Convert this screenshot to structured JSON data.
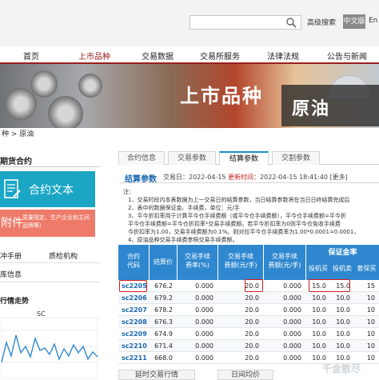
{
  "topbar": {
    "search_button": "高级搜索",
    "lang_active": "中文版",
    "lang_en": "En"
  },
  "nav": {
    "items": [
      "首页",
      "上市品种",
      "交易数据",
      "交易所服务",
      "法律法规",
      "公告与新闻"
    ],
    "active_index": 1,
    "accent": "#9b1e1e"
  },
  "banner": {
    "title": "上市品种",
    "subtitle": "原油"
  },
  "breadcrumb": "种 > 原油",
  "sidebar": {
    "section_title": "期货合约",
    "contract_button": "合约文本",
    "notice_button": "附件",
    "notice_text": "质量规定、生产企业和主间品牌等）",
    "links": [
      "冲手册",
      "质检机构",
      "库信息"
    ],
    "chart_title": "行情走势",
    "chart_label": "SC"
  },
  "tabs": {
    "items": [
      "合约信息",
      "交易参数",
      "结算参数",
      "交割参数"
    ],
    "active_index": 2
  },
  "settle": {
    "title": "结算参数",
    "date_label": "交易日：",
    "date_value": "2022-04-15",
    "update_label": "更新时间：",
    "update_value": "2022-04-15 18:41:40",
    "more": "[更多]"
  },
  "notes": [
    "注：",
    "1、交易时段内本表数据为上一交易日的结算参数，当日结算参数将在当日日终结算完成后",
    "2、表中的数据保证金、手续费，单位：元/手",
    "3、平今折扣率用于计算平今仓手续费额（或平今仓手续费额），平今仓手续费额=平今折",
    "平今仓手续费额=平今仓折扣率*交易手续费额。若平今折扣率为0则平今仓免收手续费",
    "今折扣率为1.00，交易手续费额为0.1%。则对应平今仓手续费率为1.00*0.0001=0.0001，",
    "4、原油品种交易手续费参照交易手续费额。"
  ],
  "table": {
    "headers": {
      "code": "合约\n代码",
      "price": "结算价",
      "fee_rate": "交易手续\n费率(%)",
      "fee_amount": "交易手续\n费额(元/手)",
      "close_today": "交易手续\n费额(元/手)",
      "margin_group": "保证金率",
      "margin_spec": "投机买",
      "margin_hedge": "投机卖",
      "margin_hedge_buy": "套保买"
    },
    "rows": [
      {
        "code": "sc2205",
        "price": "676.2",
        "fee_rate": "0.000",
        "fee_amount": "20.0",
        "close_today": "0.000",
        "spec_buy": "15.0",
        "spec_sell": "15.0",
        "hedge": "15"
      },
      {
        "code": "sc2206",
        "price": "679.2",
        "fee_rate": "0.000",
        "fee_amount": "20.0",
        "close_today": "0.000",
        "spec_buy": "10.0",
        "spec_sell": "10.0",
        "hedge": "10"
      },
      {
        "code": "sc2207",
        "price": "678.2",
        "fee_rate": "0.000",
        "fee_amount": "20.0",
        "close_today": "0.000",
        "spec_buy": "10.0",
        "spec_sell": "10.0",
        "hedge": "10"
      },
      {
        "code": "sc2208",
        "price": "676.3",
        "fee_rate": "0.000",
        "fee_amount": "20.0",
        "close_today": "0.000",
        "spec_buy": "10.0",
        "spec_sell": "10.0",
        "hedge": "10"
      },
      {
        "code": "sc2209",
        "price": "674.9",
        "fee_rate": "0.000",
        "fee_amount": "20.0",
        "close_today": "0.000",
        "spec_buy": "10.0",
        "spec_sell": "10.0",
        "hedge": "10"
      },
      {
        "code": "sc2210",
        "price": "671.4",
        "fee_rate": "0.000",
        "fee_amount": "20.0",
        "close_today": "0.000",
        "spec_buy": "10.0",
        "spec_sell": "10.0",
        "hedge": "10"
      },
      {
        "code": "sc2211",
        "price": "668.0",
        "fee_rate": "0.000",
        "fee_amount": "20.0",
        "close_today": "0.000",
        "spec_buy": "10.0",
        "spec_sell": "10.0",
        "hedge": "10"
      }
    ]
  },
  "bottom_tabs": [
    "延时交易行情",
    "日间均价"
  ],
  "watermark": "千金散尽"
}
